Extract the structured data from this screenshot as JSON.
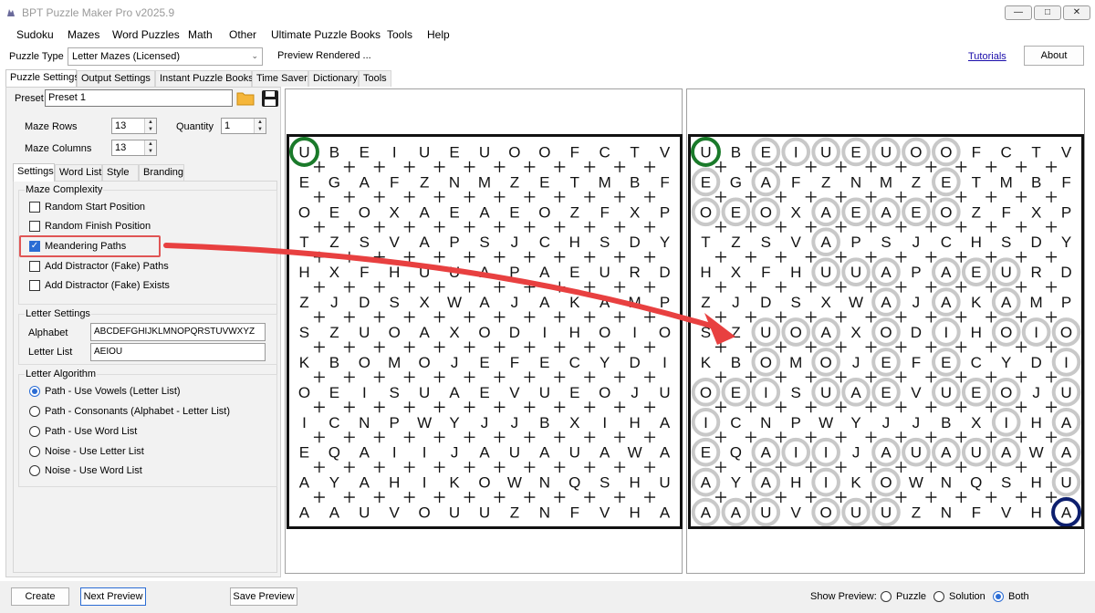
{
  "window": {
    "title": "BPT Puzzle Maker Pro v2025.9",
    "icons": {
      "app": "puzzle-app-icon",
      "minimize": "minimize-icon",
      "maximize": "maximize-icon",
      "close": "close-icon"
    }
  },
  "menu": [
    "Sudoku",
    "Mazes",
    "Word Puzzles",
    "Math",
    "Other",
    "Ultimate Puzzle Books",
    "Tools",
    "Help"
  ],
  "toolbar": {
    "puzzle_type_label": "Puzzle Type",
    "puzzle_type_value": "Letter Mazes (Licensed)",
    "preview_status": "Preview Rendered ...",
    "tutorials_link": "Tutorials",
    "about_button": "About"
  },
  "main_tabs": [
    "Puzzle Settings",
    "Output Settings",
    "Instant Puzzle Books",
    "Time Saver",
    "Dictionary",
    "Tools"
  ],
  "settings": {
    "preset_label": "Preset",
    "preset_value": "Preset 1",
    "maze_rows_label": "Maze Rows",
    "maze_rows_value": "13",
    "quantity_label": "Quantity",
    "quantity_value": "1",
    "maze_columns_label": "Maze Columns",
    "maze_columns_value": "13",
    "sub_tabs": [
      "Settings",
      "Word List",
      "Style",
      "Branding"
    ],
    "complexity_title": "Maze Complexity",
    "complexity_options": [
      {
        "label": "Random Start Position",
        "checked": false
      },
      {
        "label": "Random Finish Position",
        "checked": false
      },
      {
        "label": "Meandering Paths",
        "checked": true
      },
      {
        "label": "Add Distractor (Fake) Paths",
        "checked": false
      },
      {
        "label": "Add Distractor (Fake) Exists",
        "checked": false
      }
    ],
    "letter_settings_title": "Letter Settings",
    "alphabet_label": "Alphabet",
    "alphabet_value": "ABCDEFGHIJKLMNOPQRSTUVWXYZ",
    "letter_list_label": "Letter List",
    "letter_list_value": "AEIOU",
    "algorithm_title": "Letter Algorithm",
    "algorithm_options": [
      {
        "label": "Path - Use Vowels (Letter List)",
        "selected": true
      },
      {
        "label": "Path - Consonants (Alphabet - Letter List)",
        "selected": false
      },
      {
        "label": "Path - Use Word List",
        "selected": false
      },
      {
        "label": "Noise - Use Letter List",
        "selected": false
      },
      {
        "label": "Noise - Use Word List",
        "selected": false
      }
    ]
  },
  "maze": {
    "rows": [
      "UBEIUEUOOFCTV",
      "EGAFZNMZETMBF",
      "OEOXAEAEOZFXP",
      "TZSVAPSJCHSDY",
      "HXFHUUAPAEURD",
      "ZJDSXWAJAKAMP",
      "SZUOAXODIHOIO",
      "KBOMOJEFECYDI",
      "OEISUAEVUEOJU",
      "ICNPWYJJBXIHA",
      "EQAIIJAUAUAWA",
      "AYAHIKOWNQSHU",
      "AAUVOUUZNFVHA"
    ],
    "solution_path": [
      [
        0,
        0
      ],
      [
        0,
        2
      ],
      [
        0,
        3
      ],
      [
        0,
        4
      ],
      [
        0,
        5
      ],
      [
        0,
        6
      ],
      [
        0,
        7
      ],
      [
        0,
        8
      ],
      [
        1,
        0
      ],
      [
        1,
        2
      ],
      [
        1,
        8
      ],
      [
        2,
        0
      ],
      [
        2,
        1
      ],
      [
        2,
        2
      ],
      [
        2,
        4
      ],
      [
        2,
        5
      ],
      [
        2,
        6
      ],
      [
        2,
        7
      ],
      [
        2,
        8
      ],
      [
        3,
        4
      ],
      [
        4,
        4
      ],
      [
        4,
        5
      ],
      [
        4,
        6
      ],
      [
        4,
        8
      ],
      [
        4,
        9
      ],
      [
        4,
        10
      ],
      [
        5,
        6
      ],
      [
        5,
        8
      ],
      [
        5,
        10
      ],
      [
        6,
        2
      ],
      [
        6,
        3
      ],
      [
        6,
        4
      ],
      [
        6,
        6
      ],
      [
        6,
        8
      ],
      [
        6,
        10
      ],
      [
        6,
        11
      ],
      [
        6,
        12
      ],
      [
        7,
        2
      ],
      [
        7,
        4
      ],
      [
        7,
        6
      ],
      [
        7,
        8
      ],
      [
        7,
        12
      ],
      [
        8,
        0
      ],
      [
        8,
        1
      ],
      [
        8,
        2
      ],
      [
        8,
        4
      ],
      [
        8,
        5
      ],
      [
        8,
        6
      ],
      [
        8,
        8
      ],
      [
        8,
        9
      ],
      [
        8,
        10
      ],
      [
        8,
        12
      ],
      [
        9,
        0
      ],
      [
        9,
        10
      ],
      [
        9,
        12
      ],
      [
        10,
        0
      ],
      [
        10,
        2
      ],
      [
        10,
        3
      ],
      [
        10,
        4
      ],
      [
        10,
        6
      ],
      [
        10,
        7
      ],
      [
        10,
        8
      ],
      [
        10,
        9
      ],
      [
        10,
        10
      ],
      [
        10,
        12
      ],
      [
        11,
        0
      ],
      [
        11,
        2
      ],
      [
        11,
        4
      ],
      [
        11,
        6
      ],
      [
        11,
        12
      ],
      [
        12,
        0
      ],
      [
        12,
        1
      ],
      [
        12,
        2
      ],
      [
        12,
        4
      ],
      [
        12,
        5
      ],
      [
        12,
        6
      ]
    ],
    "start": [
      0,
      0
    ],
    "finish": [
      12,
      12
    ],
    "colors": {
      "start": "#1a7a2a",
      "finish": "#0d1f6e",
      "path": "#c8c8c8",
      "arrow": "#e84040",
      "highlight": "#e05555"
    }
  },
  "bottom": {
    "create_button": "Create",
    "next_preview_button": "Next Preview",
    "save_preview_button": "Save Preview",
    "show_preview_label": "Show Preview:",
    "options": [
      {
        "label": "Puzzle",
        "selected": false
      },
      {
        "label": "Solution",
        "selected": false
      },
      {
        "label": "Both",
        "selected": true
      }
    ]
  }
}
